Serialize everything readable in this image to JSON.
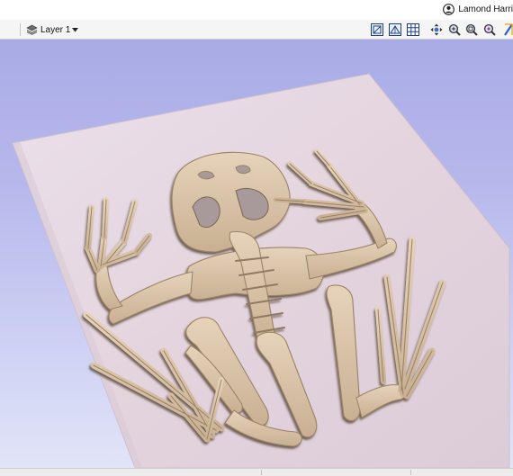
{
  "user": {
    "name": "Lamond Harri",
    "icon": "user-circle-icon"
  },
  "toolbar": {
    "layer_label": "Layer 1",
    "layer_icon": "layer-stack-icon",
    "view_buttons": [
      "view-top-icon",
      "view-iso-icon",
      "grid-toggle-icon",
      "pan-icon",
      "zoom-in-icon",
      "zoom-extents-icon",
      "zoom-selection-icon",
      "render-options-icon"
    ]
  },
  "colors": {
    "viewport_top": "#a9abe6",
    "viewport_bottom": "#e2e4f8",
    "board": "#e4d6e0",
    "bone": "#d9c3a6",
    "bone_shadow": "#8f7a62"
  }
}
